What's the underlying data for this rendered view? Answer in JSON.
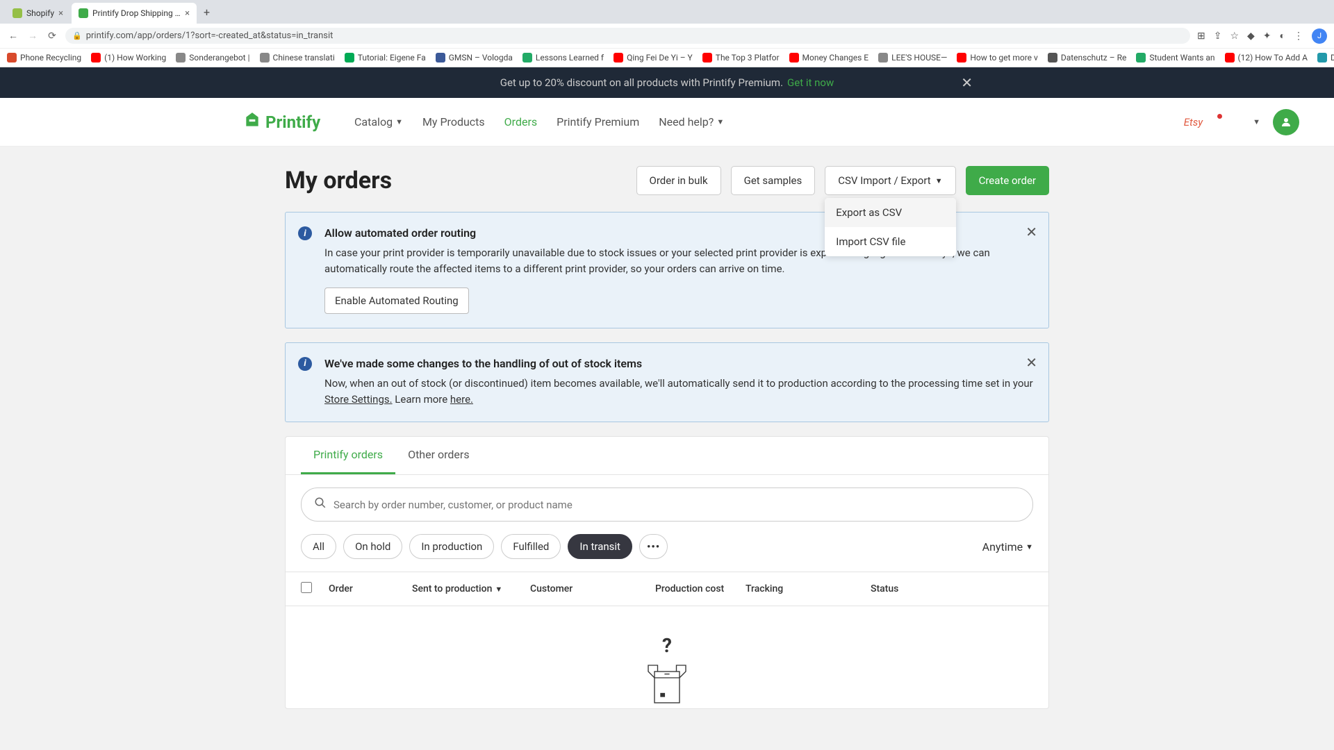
{
  "browser": {
    "tabs": [
      {
        "title": "Shopify",
        "favicon": "#95bf47"
      },
      {
        "title": "Printify Drop Shipping Print on",
        "favicon": "#3fab49"
      }
    ],
    "url": "printify.com/app/orders/1?sort=-created_at&status=in_transit",
    "bookmarks": [
      {
        "label": "Phone Recycling",
        "ic": "#d84a2c"
      },
      {
        "label": "(1) How Working",
        "ic": "#f00"
      },
      {
        "label": "Sonderangebot |",
        "ic": "#888"
      },
      {
        "label": "Chinese translati",
        "ic": "#888"
      },
      {
        "label": "Tutorial: Eigene Fa",
        "ic": "#0a5"
      },
      {
        "label": "GMSN – Vologda",
        "ic": "#3b5998"
      },
      {
        "label": "Lessons Learned f",
        "ic": "#2a6"
      },
      {
        "label": "Qing Fei De Yi – Y",
        "ic": "#f00"
      },
      {
        "label": "The Top 3 Platfor",
        "ic": "#f00"
      },
      {
        "label": "Money Changes E",
        "ic": "#f00"
      },
      {
        "label": "LEE'S HOUSE—",
        "ic": "#888"
      },
      {
        "label": "How to get more v",
        "ic": "#f00"
      },
      {
        "label": "Datenschutz – Re",
        "ic": "#555"
      },
      {
        "label": "Student Wants an",
        "ic": "#2a6"
      },
      {
        "label": "(12) How To Add A",
        "ic": "#f00"
      },
      {
        "label": "Download – Cooki",
        "ic": "#29a"
      }
    ]
  },
  "promo": {
    "text": "Get up to 20% discount on all products with Printify Premium.",
    "cta": "Get it now"
  },
  "nav": {
    "logo": "Printify",
    "links": [
      {
        "label": "Catalog",
        "caret": true
      },
      {
        "label": "My Products"
      },
      {
        "label": "Orders",
        "active": true
      },
      {
        "label": "Printify Premium"
      },
      {
        "label": "Need help?",
        "caret": true
      }
    ],
    "store": "Etsy"
  },
  "page": {
    "title": "My orders",
    "buttons": {
      "bulk": "Order in bulk",
      "samples": "Get samples",
      "csv": "CSV Import / Export",
      "create": "Create order"
    },
    "csv_menu": {
      "export": "Export as CSV",
      "import": "Import CSV file"
    }
  },
  "info1": {
    "title": "Allow automated order routing",
    "text": "In case your print provider is temporarily unavailable due to stock issues or your selected print provider is experiencing significant delays, we can automatically route the affected items to a different print provider, so your orders can arrive on time.",
    "button": "Enable Automated Routing"
  },
  "info2": {
    "title": "We've made some changes to the handling of out of stock items",
    "text_pre": "Now, when an out of stock (or discontinued) item becomes available, we'll automatically send it to production according to the processing time set in your ",
    "link1": "Store Settings.",
    "text_mid": " Learn more ",
    "link2": "here."
  },
  "tabs": {
    "printify": "Printify orders",
    "other": "Other orders"
  },
  "search": {
    "placeholder": "Search by order number, customer, or product name"
  },
  "filters": {
    "chips": [
      "All",
      "On hold",
      "In production",
      "Fulfilled",
      "In transit"
    ],
    "active_index": 4,
    "more": "•••",
    "anytime": "Anytime"
  },
  "columns": {
    "order": "Order",
    "sent": "Sent to production",
    "customer": "Customer",
    "cost": "Production cost",
    "tracking": "Tracking",
    "status": "Status"
  }
}
